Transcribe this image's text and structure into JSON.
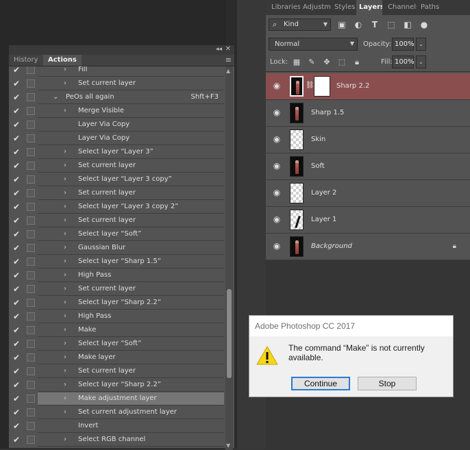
{
  "actions_panel": {
    "tabs": [
      "History",
      "Actions"
    ],
    "active_tab": "Actions",
    "collapse_glyph": "◂◂",
    "close_glyph": "✕",
    "menu_glyph": "≡",
    "rows": [
      {
        "label": "Fill",
        "chevron": "›",
        "indent": 1
      },
      {
        "label": "Set current layer",
        "chevron": "›",
        "indent": 1
      },
      {
        "label": "PeOs all again",
        "chevron": "⌄",
        "indent": 0,
        "shortcut": "Shft+F3"
      },
      {
        "label": "Merge Visible",
        "chevron": "›",
        "indent": 1
      },
      {
        "label": "Layer Via Copy",
        "chevron": "",
        "indent": 1
      },
      {
        "label": "Layer Via Copy",
        "chevron": "",
        "indent": 1
      },
      {
        "label": "Select layer “Layer 3”",
        "chevron": "›",
        "indent": 1
      },
      {
        "label": "Set current layer",
        "chevron": "›",
        "indent": 1
      },
      {
        "label": "Select layer “Layer 3 copy”",
        "chevron": "›",
        "indent": 1
      },
      {
        "label": "Set current layer",
        "chevron": "›",
        "indent": 1
      },
      {
        "label": "Select layer “Layer 3 copy 2”",
        "chevron": "›",
        "indent": 1
      },
      {
        "label": "Set current layer",
        "chevron": "›",
        "indent": 1
      },
      {
        "label": "Select layer “Soft”",
        "chevron": "›",
        "indent": 1
      },
      {
        "label": "Gaussian Blur",
        "chevron": "›",
        "indent": 1
      },
      {
        "label": "Select layer “Sharp 1.5”",
        "chevron": "›",
        "indent": 1
      },
      {
        "label": "High Pass",
        "chevron": "›",
        "indent": 1
      },
      {
        "label": "Set current layer",
        "chevron": "›",
        "indent": 1
      },
      {
        "label": "Select layer “Sharp 2.2”",
        "chevron": "›",
        "indent": 1
      },
      {
        "label": "High Pass",
        "chevron": "›",
        "indent": 1
      },
      {
        "label": "Make",
        "chevron": "›",
        "indent": 1
      },
      {
        "label": "Select layer “Soft”",
        "chevron": "›",
        "indent": 1
      },
      {
        "label": "Make layer",
        "chevron": "›",
        "indent": 1
      },
      {
        "label": "Set current layer",
        "chevron": "›",
        "indent": 1
      },
      {
        "label": "Select layer “Sharp 2.2”",
        "chevron": "›",
        "indent": 1
      },
      {
        "label": "Make adjustment layer",
        "chevron": "›",
        "indent": 1,
        "selected": true
      },
      {
        "label": "Set current adjustment layer",
        "chevron": "›",
        "indent": 1
      },
      {
        "label": "Invert",
        "chevron": "",
        "indent": 1
      },
      {
        "label": "Select RGB channel",
        "chevron": "›",
        "indent": 1
      }
    ]
  },
  "layers_panel": {
    "tabs": [
      "Libraries",
      "Adjustm",
      "Styles",
      "Layers",
      "Channels",
      "Paths"
    ],
    "active_tab": "Layers",
    "filter": {
      "search_glyph": "⌕",
      "kind": "Kind"
    },
    "blend_mode": "Normal",
    "opacity_label": "Opacity:",
    "opacity": "100%",
    "lock_label": "Lock:",
    "fill_label": "Fill:",
    "fill": "100%",
    "layers": [
      {
        "name": "Sharp 2.2",
        "thumb": "photo",
        "mask": true,
        "selected": true
      },
      {
        "name": "Sharp 1.5",
        "thumb": "photo"
      },
      {
        "name": "Skin",
        "thumb": "trans"
      },
      {
        "name": "Soft",
        "thumb": "photo"
      },
      {
        "name": "Layer 2",
        "thumb": "trans"
      },
      {
        "name": "Layer 1",
        "thumb": "trans-mark"
      },
      {
        "name": "Background",
        "thumb": "photo",
        "italic": true,
        "locked": true
      }
    ]
  },
  "dialog": {
    "title": "Adobe Photoshop CC 2017",
    "message": "The command “Make” is not currently available.",
    "buttons": {
      "continue": "Continue",
      "stop": "Stop"
    }
  },
  "colors": {
    "selected_layer": "#8a4e4e",
    "selected_action": "#757575",
    "panel_bg": "#535353",
    "default_button_border": "#2a7ad5",
    "warning_yellow": "#f5d61a"
  }
}
